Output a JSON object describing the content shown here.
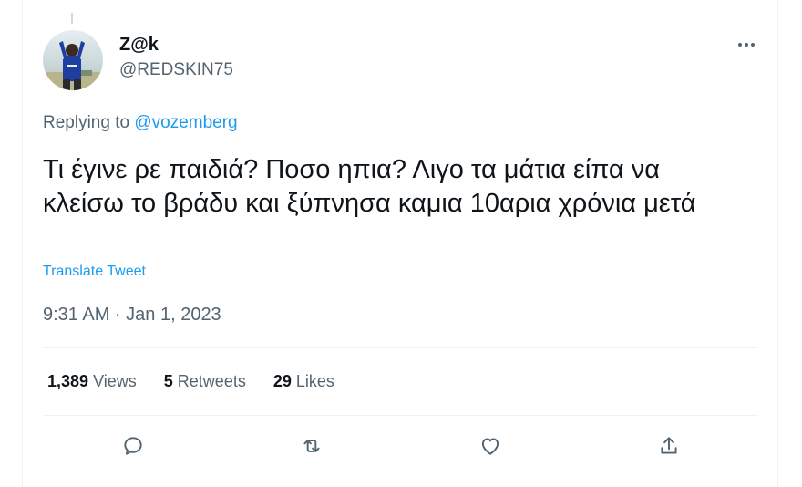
{
  "user": {
    "display_name": "Z@k",
    "handle": "@REDSKIN75"
  },
  "reply": {
    "prefix": "Replying to ",
    "mention": "@vozemberg"
  },
  "tweet": {
    "text": "Τι έγινε ρε παιδιά? Ποσο ηπια? Λιγο τα μάτια είπα να κλείσω το βράδυ και ξύπνησα καμια 10αρια χρόνια μετά",
    "translate_label": "Translate Tweet",
    "timestamp": "9:31 AM · Jan 1, 2023"
  },
  "stats": {
    "views_count": "1,389",
    "views_label": "Views",
    "retweets_count": "5",
    "retweets_label": "Retweets",
    "likes_count": "29",
    "likes_label": "Likes"
  },
  "icons": {
    "more": "more-horizontal-icon",
    "reply": "reply-icon",
    "retweet": "retweet-icon",
    "like": "heart-icon",
    "share": "share-icon"
  },
  "colors": {
    "accent": "#1d9bf0",
    "text_primary": "#0f1419",
    "text_secondary": "#536471",
    "divider": "#eff3f4"
  }
}
